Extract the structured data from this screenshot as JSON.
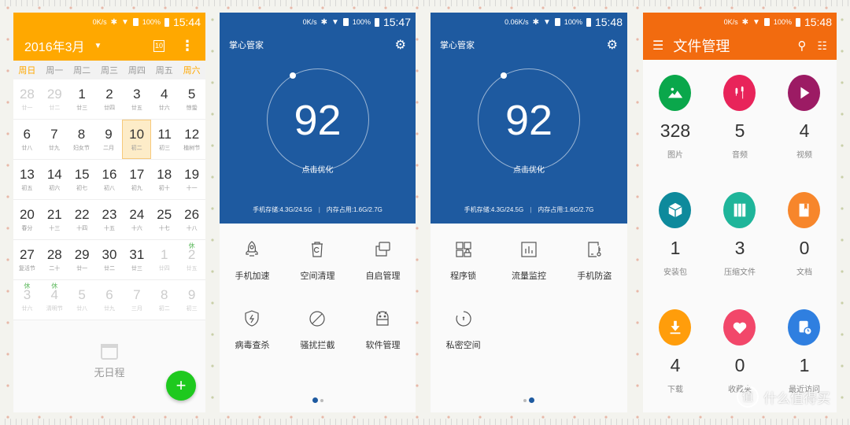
{
  "calendar": {
    "status": {
      "speed": "0K/s",
      "battery": "100%",
      "time": "15:44"
    },
    "month_title": "2016年3月",
    "today_icon_label": "10",
    "accent": "#ffa800",
    "weekdays": [
      "周日",
      "周一",
      "周二",
      "周三",
      "周四",
      "周五",
      "周六"
    ],
    "weeks": [
      [
        {
          "d": "28",
          "l": "廿一",
          "o": true
        },
        {
          "d": "29",
          "l": "廿二",
          "o": true
        },
        {
          "d": "1",
          "l": "廿三"
        },
        {
          "d": "2",
          "l": "廿四"
        },
        {
          "d": "3",
          "l": "廿五"
        },
        {
          "d": "4",
          "l": "廿六"
        },
        {
          "d": "5",
          "l": "惊蛰"
        }
      ],
      [
        {
          "d": "6",
          "l": "廿八"
        },
        {
          "d": "7",
          "l": "廿九"
        },
        {
          "d": "8",
          "l": "妇女节"
        },
        {
          "d": "9",
          "l": "二月"
        },
        {
          "d": "10",
          "l": "初二",
          "today": true
        },
        {
          "d": "11",
          "l": "初三"
        },
        {
          "d": "12",
          "l": "植树节"
        }
      ],
      [
        {
          "d": "13",
          "l": "初五"
        },
        {
          "d": "14",
          "l": "初六"
        },
        {
          "d": "15",
          "l": "初七"
        },
        {
          "d": "16",
          "l": "初八"
        },
        {
          "d": "17",
          "l": "初九"
        },
        {
          "d": "18",
          "l": "初十"
        },
        {
          "d": "19",
          "l": "十一"
        }
      ],
      [
        {
          "d": "20",
          "l": "春分"
        },
        {
          "d": "21",
          "l": "十三"
        },
        {
          "d": "22",
          "l": "十四"
        },
        {
          "d": "23",
          "l": "十五"
        },
        {
          "d": "24",
          "l": "十六"
        },
        {
          "d": "25",
          "l": "十七"
        },
        {
          "d": "26",
          "l": "十八"
        }
      ],
      [
        {
          "d": "27",
          "l": "复活节"
        },
        {
          "d": "28",
          "l": "二十"
        },
        {
          "d": "29",
          "l": "廿一"
        },
        {
          "d": "30",
          "l": "廿二"
        },
        {
          "d": "31",
          "l": "廿三"
        },
        {
          "d": "1",
          "l": "廿四",
          "o": true
        },
        {
          "d": "2",
          "l": "廿五",
          "o": true,
          "rest": "休"
        }
      ],
      [
        {
          "d": "3",
          "l": "廿六",
          "o": true,
          "rest": "休"
        },
        {
          "d": "4",
          "l": "清明节",
          "o": true,
          "rest": "休"
        },
        {
          "d": "5",
          "l": "廿八",
          "o": true
        },
        {
          "d": "6",
          "l": "廿九",
          "o": true
        },
        {
          "d": "7",
          "l": "三月",
          "o": true
        },
        {
          "d": "8",
          "l": "初二",
          "o": true
        },
        {
          "d": "9",
          "l": "初三",
          "o": true
        }
      ]
    ],
    "empty_text": "无日程",
    "fab_label": "+"
  },
  "manager1": {
    "status": {
      "speed": "0K/s",
      "battery": "100%",
      "time": "15:47"
    },
    "title": "掌心管家",
    "score": "92",
    "cta": "点击优化",
    "storage": "手机存储:4.3G/24.5G",
    "memory": "内存占用:1.6G/2.7G",
    "tools": [
      {
        "icon": "rocket",
        "label": "手机加速"
      },
      {
        "icon": "trash",
        "label": "空间清理"
      },
      {
        "icon": "windows",
        "label": "自启管理"
      },
      {
        "icon": "shield",
        "label": "病毒查杀"
      },
      {
        "icon": "block",
        "label": "骚扰拦截"
      },
      {
        "icon": "android",
        "label": "软件管理"
      }
    ],
    "page": 1,
    "pages": 2
  },
  "manager2": {
    "status": {
      "speed": "0.06K/s",
      "battery": "100%",
      "time": "15:48"
    },
    "title": "掌心管家",
    "score": "92",
    "cta": "点击优化",
    "storage": "手机存储:4.3G/24.5G",
    "memory": "内存占用:1.6G/2.7G",
    "tools": [
      {
        "icon": "applock",
        "label": "程序锁"
      },
      {
        "icon": "traffic",
        "label": "流量监控"
      },
      {
        "icon": "antitheft",
        "label": "手机防盗"
      },
      {
        "icon": "private",
        "label": "私密空间"
      }
    ],
    "page": 2,
    "pages": 2
  },
  "files": {
    "status": {
      "speed": "0K/s",
      "battery": "100%",
      "time": "15:48"
    },
    "title": "文件管理",
    "accent": "#f26b0f",
    "categories": [
      {
        "icon": "image",
        "name": "图片",
        "count": "328",
        "color": "#0aa74b"
      },
      {
        "icon": "music",
        "name": "音频",
        "count": "5",
        "color": "#e8245a"
      },
      {
        "icon": "video",
        "name": "视频",
        "count": "4",
        "color": "#9c1b64"
      },
      {
        "icon": "package",
        "name": "安装包",
        "count": "1",
        "color": "#0e8a9c"
      },
      {
        "icon": "archive",
        "name": "压缩文件",
        "count": "3",
        "color": "#1fb59a"
      },
      {
        "icon": "document",
        "name": "文档",
        "count": "0",
        "color": "#f7862b"
      },
      {
        "icon": "download",
        "name": "下载",
        "count": "4",
        "color": "#ff9d0b"
      },
      {
        "icon": "heart",
        "name": "收藏夹",
        "count": "0",
        "color": "#f2476a"
      },
      {
        "icon": "recent",
        "name": "最近访问",
        "count": "1",
        "color": "#2f7fe0"
      }
    ]
  },
  "watermark": {
    "logo": "值",
    "text": "什么值得买"
  }
}
